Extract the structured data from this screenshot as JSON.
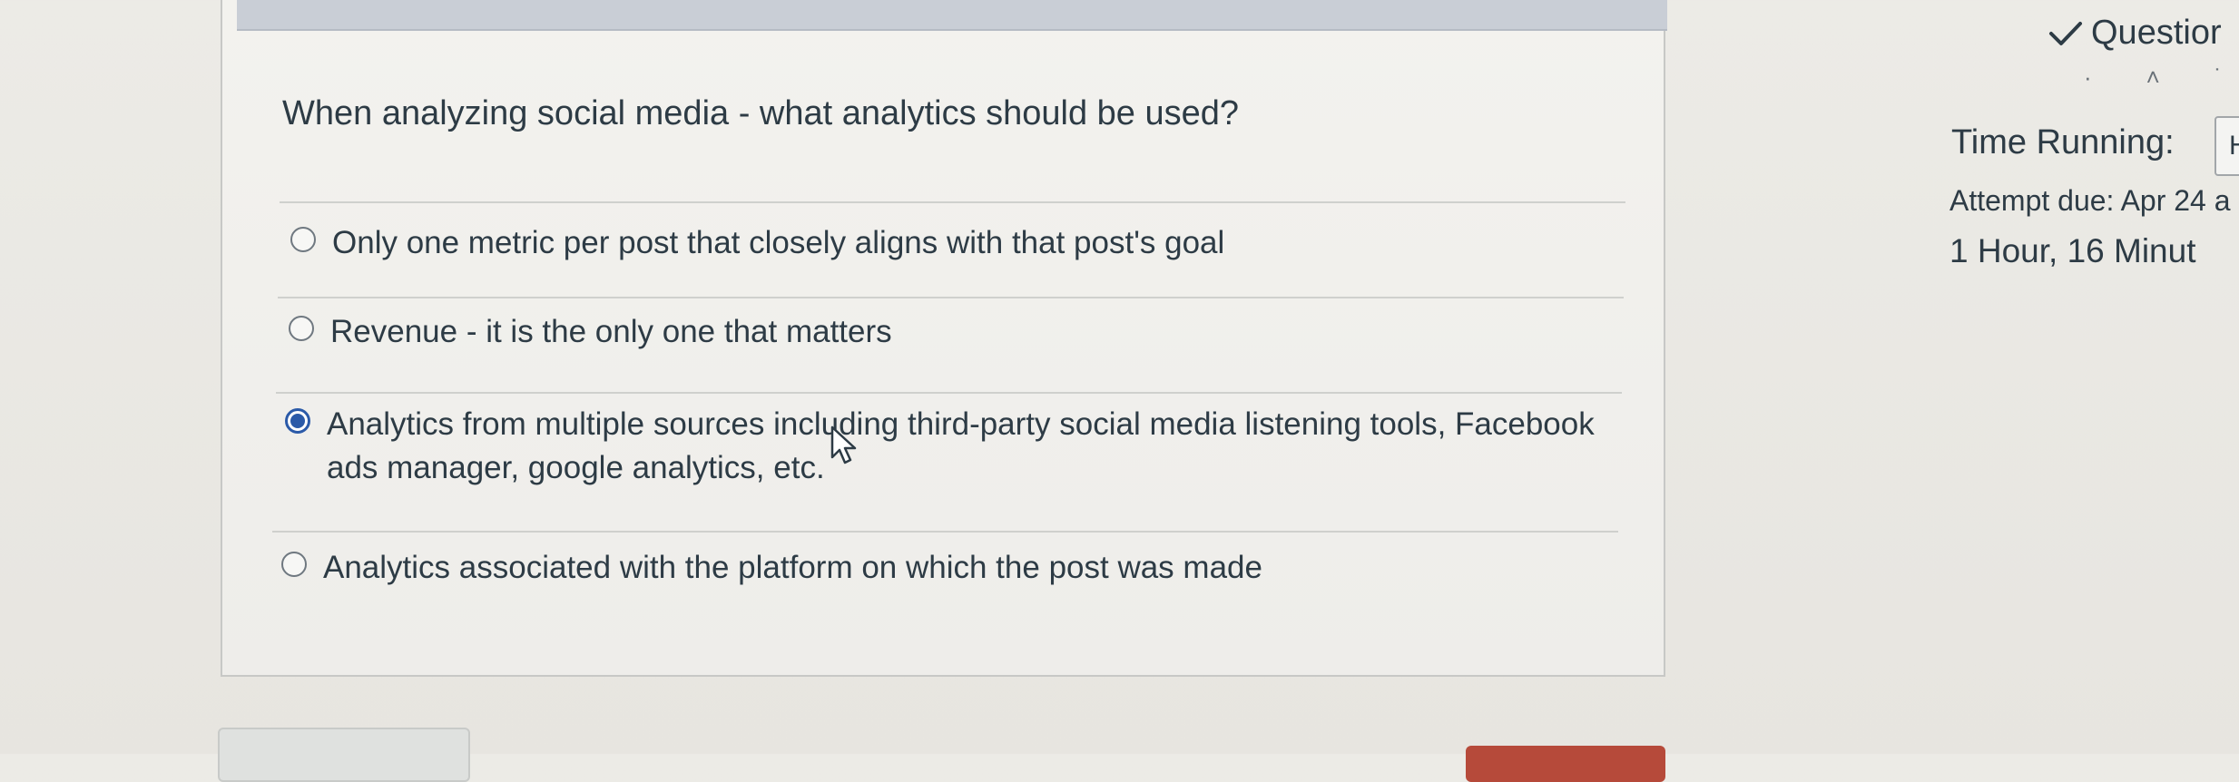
{
  "question": {
    "text": "When analyzing social media - what analytics should be used?",
    "answers": [
      {
        "label": "Only one metric per post that closely aligns with that post's goal",
        "selected": false
      },
      {
        "label": "Revenue - it is the only one that matters",
        "selected": false
      },
      {
        "label": "Analytics from multiple sources including third-party social media listening tools, Facebook ads manager, google analytics, etc.",
        "selected": true
      },
      {
        "label": "Analytics associated with the platform on which the post was made",
        "selected": false
      }
    ]
  },
  "sidebar": {
    "questions_label": "Questior",
    "time_running_label": "Time Running:",
    "timer_box_text": "H",
    "attempt_due": "Attempt due: Apr 24 a",
    "time_remaining": "1 Hour, 16 Minut"
  },
  "icons": {
    "check": "check-icon",
    "cursor": "mouse-cursor-icon"
  },
  "colors": {
    "selected_radio": "#2b5aa8",
    "header_bar": "#c9ced6",
    "bottom_button_red": "#b64a3a"
  }
}
